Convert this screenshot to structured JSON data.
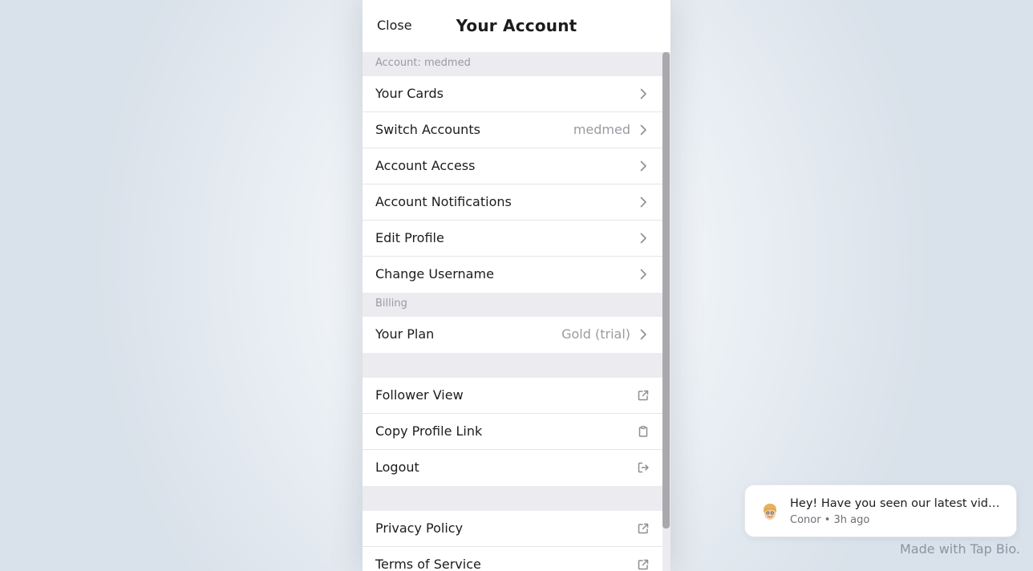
{
  "header": {
    "close_label": "Close",
    "title": "Your Account"
  },
  "sections": {
    "account_header": "Account: medmed",
    "billing_header": "Billing"
  },
  "account_rows": [
    {
      "label": "Your Cards",
      "value": "",
      "icon": "chevron-right-icon"
    },
    {
      "label": "Switch Accounts",
      "value": "medmed",
      "icon": "chevron-right-icon"
    },
    {
      "label": "Account Access",
      "value": "",
      "icon": "chevron-right-icon"
    },
    {
      "label": "Account Notifications",
      "value": "",
      "icon": "chevron-right-icon"
    },
    {
      "label": "Edit Profile",
      "value": "",
      "icon": "chevron-right-icon"
    },
    {
      "label": "Change Username",
      "value": "",
      "icon": "chevron-right-icon"
    }
  ],
  "billing_rows": [
    {
      "label": "Your Plan",
      "value": "Gold (trial)",
      "icon": "chevron-right-icon"
    }
  ],
  "action_rows": [
    {
      "label": "Follower View",
      "icon": "external-link-icon"
    },
    {
      "label": "Copy Profile Link",
      "icon": "clipboard-icon"
    },
    {
      "label": "Logout",
      "icon": "logout-icon"
    }
  ],
  "legal_rows": [
    {
      "label": "Privacy Policy",
      "icon": "external-link-icon"
    },
    {
      "label": "Terms of Service",
      "icon": "external-link-icon"
    }
  ],
  "notification": {
    "message": "Hey! Have you seen our latest vid…",
    "meta": "Conor • 3h ago",
    "avatar_icon": "avatar-icon"
  },
  "footer": {
    "credit": "Made with Tap Bio."
  },
  "colors": {
    "text_primary": "#1c1c1e",
    "text_secondary": "#9a9aa2",
    "section_bg": "#ecebf0",
    "row_bg": "#ffffff",
    "icon": "#8e8e93"
  }
}
